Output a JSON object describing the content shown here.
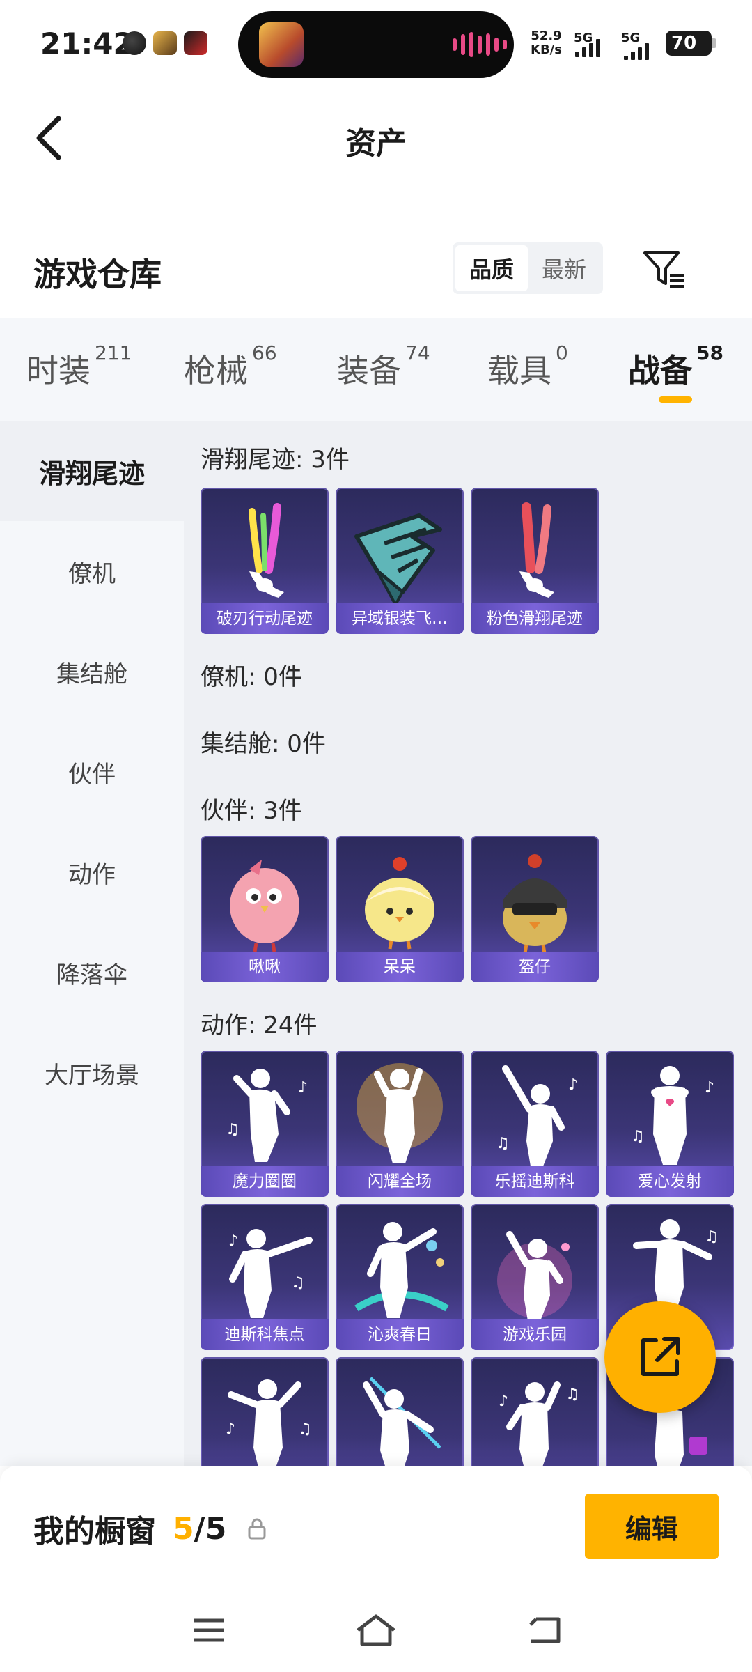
{
  "status": {
    "time": "21:42",
    "net_speed_value": "52.9",
    "net_speed_unit": "KB/s",
    "sim1": "5G",
    "sim2": "5G",
    "battery": "70"
  },
  "header": {
    "title": "资产"
  },
  "section": {
    "title": "游戏仓库",
    "sort_options": [
      "品质",
      "最新"
    ],
    "sort_selected": "品质"
  },
  "tabs": [
    {
      "label": "时装",
      "count": "211"
    },
    {
      "label": "枪械",
      "count": "66"
    },
    {
      "label": "装备",
      "count": "74"
    },
    {
      "label": "载具",
      "count": "0"
    },
    {
      "label": "战备",
      "count": "58"
    }
  ],
  "sidebar": {
    "items": [
      "滑翔尾迹",
      "僚机",
      "集结舱",
      "伙伴",
      "动作",
      "降落伞",
      "大厅场景"
    ],
    "selected": "滑翔尾迹"
  },
  "content": {
    "groups": [
      {
        "title": "滑翔尾迹: 3件",
        "items": [
          "破刃行动尾迹",
          "异域银装飞…",
          "粉色滑翔尾迹"
        ]
      },
      {
        "title": "僚机: 0件",
        "items": []
      },
      {
        "title": "集结舱: 0件",
        "items": []
      },
      {
        "title": "伙伴: 3件",
        "items": [
          "啾啾",
          "呆呆",
          "盔仔"
        ]
      },
      {
        "title": "动作: 24件",
        "items": [
          "魔力圈圈",
          "闪耀全场",
          "乐摇迪斯科",
          "爱心发射",
          "迪斯科焦点",
          "沁爽春日",
          "游戏乐园"
        ]
      }
    ]
  },
  "showcase": {
    "label": "我的橱窗",
    "current": "5",
    "separator": "/",
    "total": "5"
  },
  "actions": {
    "edit": "编辑"
  },
  "colors": {
    "accent": "#ffb300",
    "card_bg": "#3b3576",
    "card_label": "#6a56c8"
  },
  "icons": [
    "back-arrow-icon",
    "filter-icon",
    "share-icon",
    "lock-icon",
    "menu-icon",
    "home-icon",
    "return-icon"
  ]
}
